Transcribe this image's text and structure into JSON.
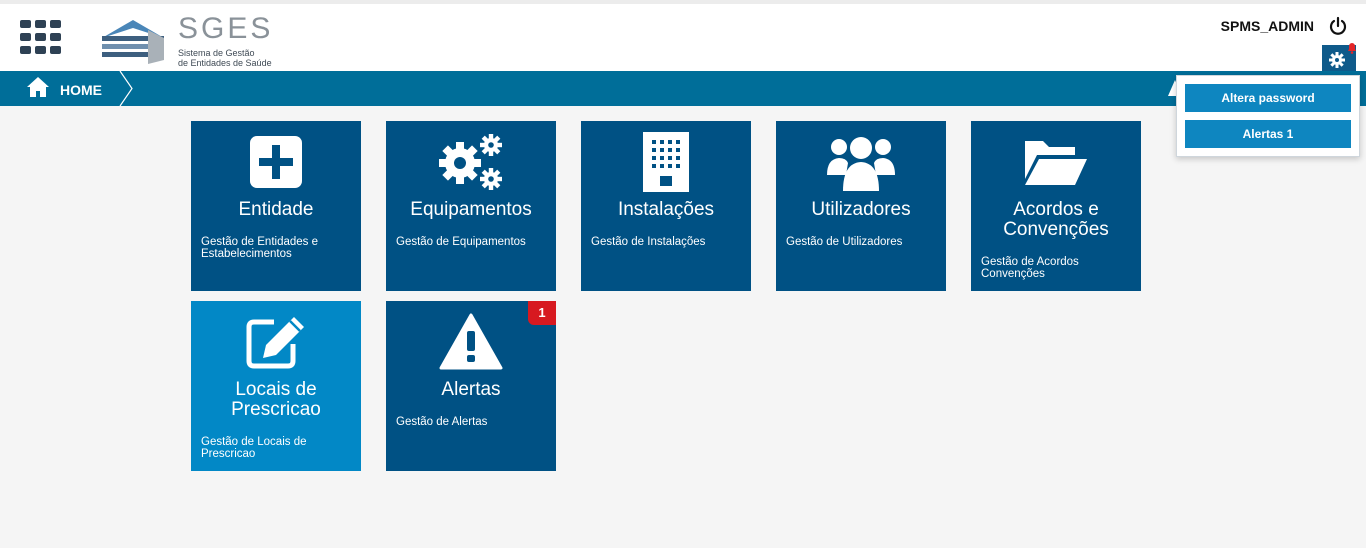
{
  "header": {
    "logo_text": "SGES",
    "logo_subtitle_line1": "Sistema de Gestão",
    "logo_subtitle_line2": "de Entidades de Saúde",
    "username": "SPMS_ADMIN"
  },
  "navbar": {
    "home_label": "HOME"
  },
  "user_menu": {
    "items": [
      "Altera password",
      "Alertas 1"
    ]
  },
  "tiles": [
    {
      "title": "Entidade",
      "description": "Gestão de Entidades e Estabelecimentos",
      "icon": "plus-square-icon"
    },
    {
      "title": "Equipamentos",
      "description": "Gestão de Equipamentos",
      "icon": "gears-icon"
    },
    {
      "title": "Instalações",
      "description": "Gestão de Instalações",
      "icon": "building-icon"
    },
    {
      "title": "Utilizadores",
      "description": "Gestão de Utilizadores",
      "icon": "users-icon"
    },
    {
      "title": "Acordos e Convenções",
      "description": "Gestão de Acordos Convenções",
      "icon": "folder-open-icon"
    },
    {
      "title": "Locais de Prescricao",
      "description": "Gestão de Locais de Prescricao",
      "icon": "edit-icon"
    },
    {
      "title": "Alertas",
      "description": "Gestão de Alertas",
      "icon": "warning-icon",
      "badge": "1"
    }
  ],
  "colors": {
    "primary_tile": "#005184",
    "highlight_tile": "#0288c6",
    "navbar": "#006e99",
    "badge": "#d71920"
  }
}
